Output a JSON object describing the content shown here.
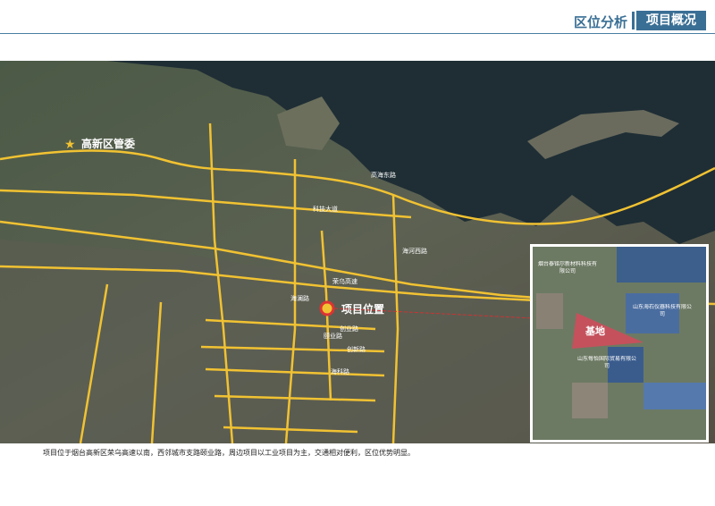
{
  "header": {
    "section_label": "区位分析",
    "active_tab": "项目概况",
    "accent_color": "#3a6f95"
  },
  "map": {
    "landmark": {
      "icon": "star-icon",
      "label": "高新区管委"
    },
    "project": {
      "label": "项目位置"
    },
    "roads": [
      "高海东路",
      "科技大道",
      "荣乌高速",
      "海河西路",
      "海澜路",
      "颐业路",
      "创新路",
      "创业路",
      "海科路"
    ],
    "inset": {
      "site_label": "基地",
      "companies": [
        "烟台泰铭尔新材料科技有限公司",
        "山东海石仪器科技有限公司",
        "山东每怡国际贸易有限公司"
      ]
    }
  },
  "caption": "项目位于烟台高新区荣乌高速以南，西邻城市支路颐业路，周边项目以工业项目为主，交通相对便利，区位优势明显。"
}
